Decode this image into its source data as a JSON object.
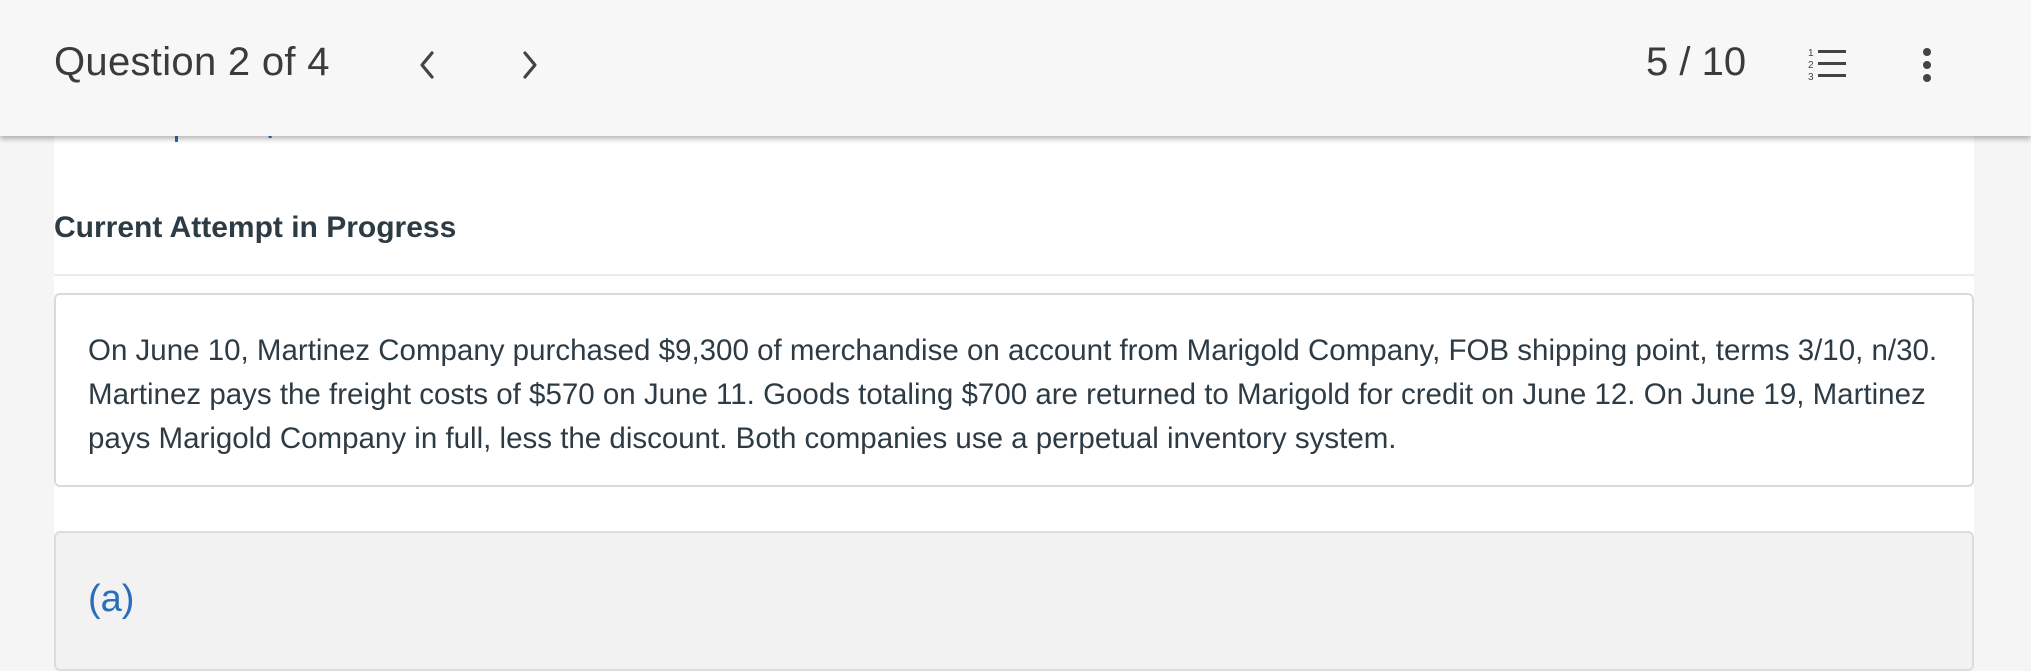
{
  "header": {
    "question_label": "Question 2 of 4",
    "score": "5 / 10",
    "prev_icon": "chevron-left-icon",
    "next_icon": "chevron-right-icon",
    "list_icon": "numbered-list-icon",
    "more_icon": "more-vertical-icon"
  },
  "main": {
    "attempt_heading": "Current Attempt in Progress",
    "problem_text": "On June 10, Martinez Company purchased $9,300 of merchandise on account from Marigold Company, FOB shipping point, terms 3/10, n/30. Martinez pays the freight costs of $570 on June 11. Goods totaling $700 are returned to Marigold for credit on June 12. On June 19, Martinez pays Marigold Company in full, less the discount. Both companies use a perpetual inventory system.",
    "part_label": "(a)"
  },
  "colors": {
    "link_blue": "#2a6ebb",
    "text_dark": "#2d3b45",
    "header_bg": "#f7f7f7"
  }
}
